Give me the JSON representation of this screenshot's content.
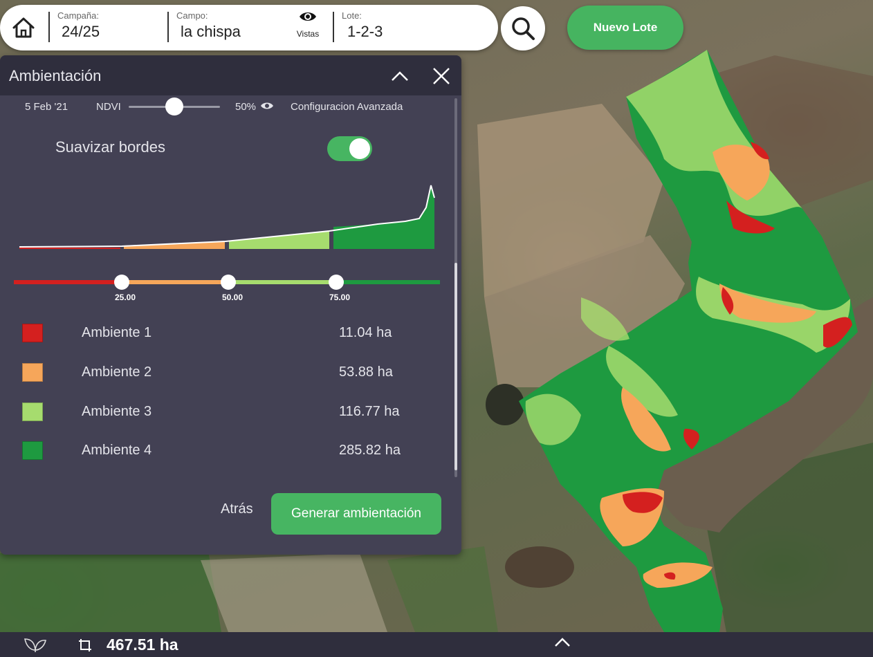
{
  "topbar": {
    "campana_label": "Campaña:",
    "campana_value": "24/25",
    "campo_label": "Campo:",
    "campo_value": "la chispa",
    "vistas_label": "Vistas",
    "lote_label": "Lote:",
    "lote_value": "1-2-3",
    "nuevo_lote": "Nuevo Lote"
  },
  "panel": {
    "title": "Ambientación",
    "date": "5 Feb '21",
    "index": "NDVI",
    "opacity": "50%",
    "opacity_level": 0.5,
    "advanced": "Configuracion Avanzada",
    "smooth_label": "Suavizar bordes",
    "smooth_on": true,
    "thresholds": [
      "25.00",
      "50.00",
      "75.00"
    ],
    "environments": [
      {
        "name": "Ambiente 1",
        "area": "11.04 ha",
        "color": "#d4201f"
      },
      {
        "name": "Ambiente 2",
        "area": "53.88 ha",
        "color": "#f6a65a"
      },
      {
        "name": "Ambiente 3",
        "area": "116.77 ha",
        "color": "#a6dc6e"
      },
      {
        "name": "Ambiente 4",
        "area": "285.82 ha",
        "color": "#1e9a40"
      }
    ],
    "back": "Atrás",
    "generate": "Generar ambientación"
  },
  "bottombar": {
    "total_area": "467.51 ha"
  },
  "colors": {
    "accent": "#47b562",
    "panel_bg": "#434154",
    "panel_header": "#2f2e3d"
  }
}
